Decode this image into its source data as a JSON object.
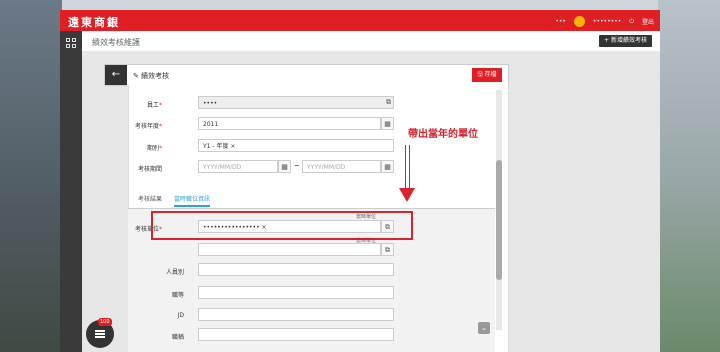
{
  "app": {
    "brand": "遠東商銀",
    "user_name": "•••",
    "user_info": "••••••••",
    "logout": "登出"
  },
  "page": {
    "title": "績效考核維護",
    "new_button": "新增績效考核"
  },
  "panel": {
    "title": "績效考核",
    "save": "存檔"
  },
  "form": {
    "employee_label": "員工",
    "employee_value": "••••",
    "year_label": "考核年度",
    "year_value": "2011",
    "type_label": "期別",
    "type_value": "Y1 - 年度 ×",
    "period_label": "考核期間",
    "date_placeholder": "YYYY/MM/DD",
    "separator": "~"
  },
  "tabs": [
    {
      "label": "考核結果"
    },
    {
      "label": "當時職位資訊"
    }
  ],
  "lower_form": {
    "unit_label": "考核單位",
    "unit_value": "•••••••••••••••• ×",
    "tag1": "當時單位",
    "tag2": "當時單位",
    "category_label": "人員別",
    "rank_label": "職等",
    "jd_label": "JD",
    "title_label": "職稱"
  },
  "annotation": "帶出當年的單位",
  "notification_count": "100",
  "colors": {
    "brand_red": "#e01f25",
    "tab_blue": "#29a3e0"
  }
}
